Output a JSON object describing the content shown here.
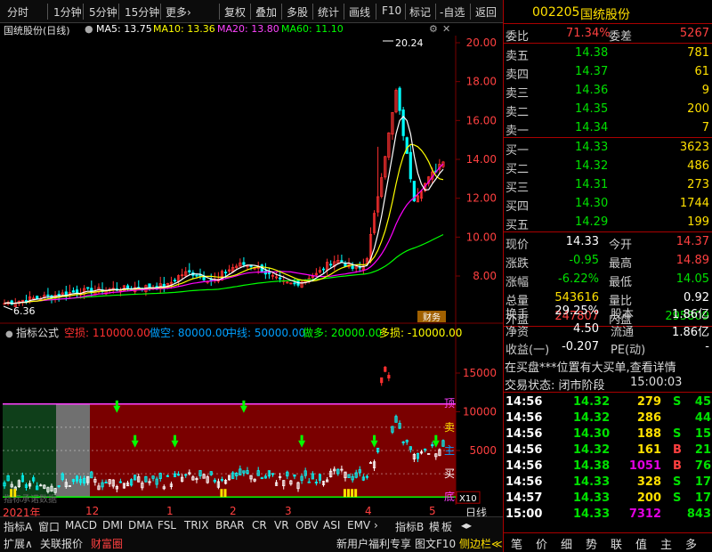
{
  "toolbar": {
    "periods": [
      "分时",
      "1分钟",
      "5分钟",
      "15分钟",
      "更多›"
    ],
    "tools": [
      "复权",
      "叠加",
      "多股",
      "统计",
      "画线",
      "F10",
      "标记",
      "-自选",
      "返回"
    ]
  },
  "kline_header": {
    "name": "国统股份(日线)",
    "ma5": "MA5: 13.75",
    "ma10": "MA10: 13.36",
    "ma20": "MA20: 13.80",
    "ma60": "MA60: 11.10"
  },
  "price_axis": [
    "20.00",
    "18.00",
    "16.00",
    "14.00",
    "12.00",
    "10.00",
    "8.00"
  ],
  "price_marks": {
    "high": "20.24",
    "low": "6.36"
  },
  "badge": "财务",
  "ind_header": {
    "name": "指标公式",
    "kong": "空损: 110000.00",
    "zuokong": "做空: 80000.00",
    "zhongxian": "中线: 50000.00",
    "zuoduo": "做多: 20000.00",
    "duosun": "多损: -10000.00"
  },
  "ind_axis": [
    "15000",
    "10000",
    "5000"
  ],
  "ind_side": {
    "ding": "顶",
    "mai_sell": "卖",
    "zhu": "主",
    "mai_buy": "买",
    "di": "底",
    "unit": "X10"
  },
  "ind_watermark": "指标承诺数据",
  "timeline": [
    "2021年",
    "12",
    "1",
    "2",
    "3",
    "4",
    "5"
  ],
  "period_label": "日线",
  "tabs1": [
    "指标A",
    "窗口",
    "MACD",
    "DMI",
    "DMA",
    "FSL",
    "TRIX",
    "BRAR",
    "CR",
    "VR",
    "OBV",
    "ASI",
    "EMV",
    "›",
    "指标B",
    "模",
    "板",
    "◂▸"
  ],
  "tabs2": [
    "扩展∧",
    "关联报价",
    "财富圈"
  ],
  "promo": [
    "新用户福利专享",
    "图文F10",
    "侧边栏≪"
  ],
  "quote": {
    "code": "002205",
    "name": "国统股份",
    "weibi": {
      "label": "委比",
      "value": "71.34%",
      "label2": "委差",
      "value2": "5267"
    },
    "asks": [
      {
        "l": "卖五",
        "p": "14.38",
        "v": "781"
      },
      {
        "l": "卖四",
        "p": "14.37",
        "v": "61"
      },
      {
        "l": "卖三",
        "p": "14.36",
        "v": "9"
      },
      {
        "l": "卖二",
        "p": "14.35",
        "v": "200"
      },
      {
        "l": "卖一",
        "p": "14.34",
        "v": "7"
      }
    ],
    "bids": [
      {
        "l": "买一",
        "p": "14.33",
        "v": "3623"
      },
      {
        "l": "买二",
        "p": "14.32",
        "v": "486"
      },
      {
        "l": "买三",
        "p": "14.31",
        "v": "273"
      },
      {
        "l": "买四",
        "p": "14.30",
        "v": "1744"
      },
      {
        "l": "买五",
        "p": "14.29",
        "v": "199"
      }
    ],
    "stats": [
      {
        "a": "现价",
        "b": "14.33",
        "c": "今开",
        "d": "14.37",
        "bc": "#ffffff",
        "dc": "#ff4040"
      },
      {
        "a": "涨跌",
        "b": "-0.95",
        "c": "最高",
        "d": "14.89",
        "bc": "#00e000",
        "dc": "#ff4040"
      },
      {
        "a": "涨幅",
        "b": "-6.22%",
        "c": "最低",
        "d": "14.05",
        "bc": "#00e000",
        "dc": "#00e000"
      },
      {
        "a": "总量",
        "b": "543616",
        "c": "量比",
        "d": "0.92",
        "bc": "#ffe000",
        "dc": "#ffffff"
      },
      {
        "a": "外盘",
        "b": "247807",
        "c": "内盘",
        "d": "295809",
        "bc": "#ff4040",
        "dc": "#00e000"
      }
    ],
    "stats2": [
      {
        "a": "换手",
        "b": "29.25%",
        "c": "股本",
        "d": "1.86亿"
      },
      {
        "a": "净资",
        "b": "4.50",
        "c": "流通",
        "d": "1.86亿"
      },
      {
        "a": "收益(一)",
        "b": "-0.207",
        "c": "PE(动)",
        "d": "-"
      }
    ],
    "notice": "在买盘***位置有大买单,查看详情",
    "status_label": "交易状态: 闭市阶段",
    "status_time": "15:00:03",
    "trades": [
      {
        "t": "14:56",
        "p": "14.32",
        "v": "279",
        "s": "S",
        "n": "45",
        "pc": "#00e000",
        "vc": "#ffe000",
        "sc": "#00e000"
      },
      {
        "t": "14:56",
        "p": "14.32",
        "v": "286",
        "s": "",
        "n": "44",
        "pc": "#00e000",
        "vc": "#ffe000",
        "sc": "#00e000"
      },
      {
        "t": "14:56",
        "p": "14.30",
        "v": "188",
        "s": "S",
        "n": "15",
        "pc": "#00e000",
        "vc": "#ffe000",
        "sc": "#00e000"
      },
      {
        "t": "14:56",
        "p": "14.32",
        "v": "161",
        "s": "B",
        "n": "21",
        "pc": "#00e000",
        "vc": "#ffe000",
        "sc": "#ff4040"
      },
      {
        "t": "14:56",
        "p": "14.38",
        "v": "1051",
        "s": "B",
        "n": "76",
        "pc": "#00e000",
        "vc": "#e000e0",
        "sc": "#ff4040"
      },
      {
        "t": "14:56",
        "p": "14.33",
        "v": "328",
        "s": "S",
        "n": "17",
        "pc": "#00e000",
        "vc": "#ffe000",
        "sc": "#00e000"
      },
      {
        "t": "14:57",
        "p": "14.33",
        "v": "200",
        "s": "S",
        "n": "17",
        "pc": "#00e000",
        "vc": "#ffe000",
        "sc": "#00e000"
      },
      {
        "t": "15:00",
        "p": "14.33",
        "v": "7312",
        "s": "",
        "n": "843",
        "pc": "#00e000",
        "vc": "#e000e0",
        "sc": "#00e000"
      }
    ]
  },
  "rtabs": [
    "笔",
    "价",
    "细",
    "势",
    "联",
    "值",
    "主",
    "多"
  ],
  "colors": {
    "up": "#ff3030",
    "down": "#00ffff",
    "ma5": "#ffffff",
    "ma10": "#ffff00",
    "ma20": "#ff00ff",
    "ma60": "#00ff00",
    "grid": "#7a0000"
  }
}
